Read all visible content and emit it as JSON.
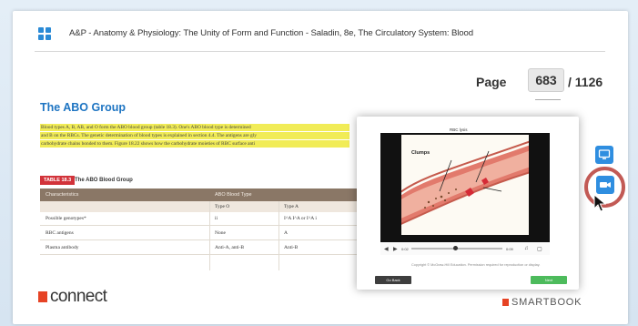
{
  "header": {
    "book_title": "A&P - Anatomy & Physiology: The Unity of Form and Function - Saladin, 8e, The Circulatory System: Blood"
  },
  "pager": {
    "label": "Page",
    "current": "683",
    "total": "/ 1126"
  },
  "section": {
    "title": "The ABO Group",
    "highlighted_lines": [
      "Blood types A, B, AB, and O form the ABO blood group (table 18.3). One's ABO blood type is determined",
      "and B on the RBCs. The genetic determination of blood types is explained in section 4.4. The antigens are gly",
      "carbohydrate chains bonded to them. Figure 18.22 shows how the carbohydrate moieties of RBC surface anti"
    ]
  },
  "table": {
    "tag": "TABLE 18.3",
    "caption": "The ABO Blood Group",
    "header_left": "Characteristics",
    "header_right": "ABO Blood Type",
    "subheaders": [
      "Type O",
      "Type A"
    ],
    "rows": [
      {
        "label": "Possible genotypes*",
        "o": "ii",
        "a": "I^A I^A or I^A i"
      },
      {
        "label": "RBC antigens",
        "o": "None",
        "a": "A"
      },
      {
        "label": "Plasma antibody",
        "o": "Anti-A, anti-B",
        "a": "Anti-B"
      }
    ]
  },
  "video": {
    "top_caption": "RBC lysis",
    "annotation": "Clumps",
    "time": "0:02",
    "end_time": "0:09",
    "copyright": "Copyright © McGraw-Hill Education. Permission required for reproduction or display.",
    "close_label": "Go Back",
    "next_label": "Next"
  },
  "brand": {
    "connect": "connect",
    "smartbook": "SMARTBOOK"
  },
  "colors": {
    "accent": "#2f8ee0",
    "title_blue": "#1d74c2",
    "highlight": "#f1ec57",
    "table_tag": "#d2333a",
    "table_header": "#8a7766",
    "logo_red": "#e64325",
    "ring": "#c25a55",
    "next_button": "#4dbb5c"
  },
  "icons": {
    "toc": "grid-icon",
    "side_top": "display-icon",
    "side_video": "video-camera-icon",
    "cursor": "mouse-pointer-icon"
  }
}
